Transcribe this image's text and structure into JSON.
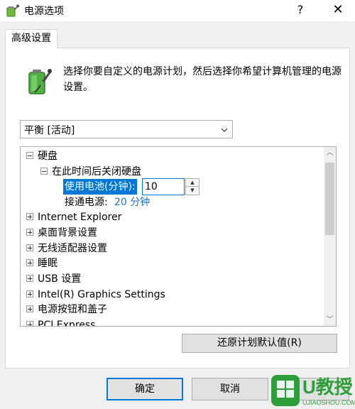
{
  "window": {
    "title": "电源选项",
    "help_glyph": "?",
    "close_glyph": "✕"
  },
  "tabs": [
    {
      "label": "高级设置",
      "active": true
    }
  ],
  "description": "选择你要自定义的电源计划，然后选择你希望计算机管理的电源设置。",
  "plan_select": {
    "value": "平衡 [活动]"
  },
  "tree": {
    "hard_disk": {
      "label": "硬盘",
      "expanded": true,
      "child": {
        "label": "在此时间后关闭硬盘",
        "expanded": true,
        "battery": {
          "label": "使用电池(分钟):",
          "value": "10"
        },
        "plugged_in": {
          "label": "接通电源:",
          "value": "20 分钟"
        }
      }
    },
    "items": [
      {
        "label": "Internet Explorer"
      },
      {
        "label": "桌面背景设置"
      },
      {
        "label": "无线适配器设置"
      },
      {
        "label": "睡眠"
      },
      {
        "label": "USB 设置"
      },
      {
        "label": "Intel(R) Graphics Settings"
      },
      {
        "label": "电源按钮和盖子"
      },
      {
        "label": "PCI Express"
      }
    ]
  },
  "buttons": {
    "restore": "还原计划默认值(R)",
    "ok": "确定",
    "cancel": "取消"
  },
  "watermark": {
    "text": "U教授",
    "subtext": "UJIAOSHOU.COM"
  },
  "colors": {
    "accent": "#0078d7",
    "link": "#1a73c6",
    "watermark": "#2e9e3a"
  }
}
